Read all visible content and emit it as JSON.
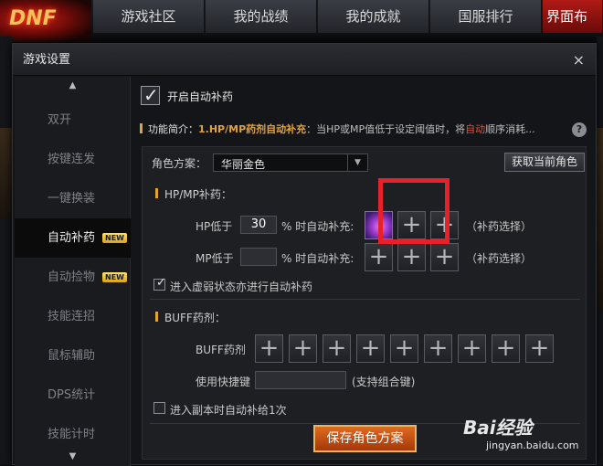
{
  "nav": {
    "tabs": [
      "游戏社区",
      "我的战绩",
      "我的成就",
      "国服排行",
      "界面布"
    ]
  },
  "dialog": {
    "title": "游戏设置",
    "close": "×"
  },
  "sidebar": {
    "items": [
      {
        "label": "双开"
      },
      {
        "label": "按键连发"
      },
      {
        "label": "一键换装"
      },
      {
        "label": "自动补药",
        "badge": "NEW"
      },
      {
        "label": "自动捡物",
        "badge": "NEW"
      },
      {
        "label": "技能连招"
      },
      {
        "label": "鼠标辅助"
      },
      {
        "label": "DPS统计"
      },
      {
        "label": "技能计时"
      }
    ],
    "active": 3
  },
  "main": {
    "enable_label": "开启自动补药",
    "enabled": true,
    "intro_tag": "功能简介：",
    "intro_bar": "1.HP/MP药剂自动补充",
    "intro_text": "：当HP或MP值低于设定阈值时，将",
    "intro_hl": "自动",
    "intro_tail": "顺序消耗...",
    "help": "?",
    "role_label": "角色方案：",
    "role_value": "华丽金色",
    "get_role_button": "获取当前角色",
    "hpmp_section": "HP/MP补药：",
    "hp_label": "HP低于",
    "hp_value": "30",
    "hp_suffix": "% 时自动补充:",
    "mp_label": "MP低于",
    "mp_value": "",
    "mp_suffix": "% 时自动补充:",
    "choose_text": "（补药选择）",
    "weak_label": "进入虚弱状态亦进行自动补药",
    "weak_checked": true,
    "buff_section": "BUFF药剂：",
    "buff_label": "BUFF药剂",
    "hotkey_label": "使用快捷键",
    "hotkey_value": "",
    "hotkey_hint": "(支持组合键)",
    "dungeon_label": "进入副本时自动补给1次",
    "dungeon_checked": false,
    "save_button": "保存角色方案"
  },
  "watermark": {
    "text": "Bai经验",
    "url": "jingyan.baidu.com"
  },
  "colors": {
    "accent": "#e2a23a",
    "highlight": "#e8202a",
    "save": "#d45a18"
  }
}
